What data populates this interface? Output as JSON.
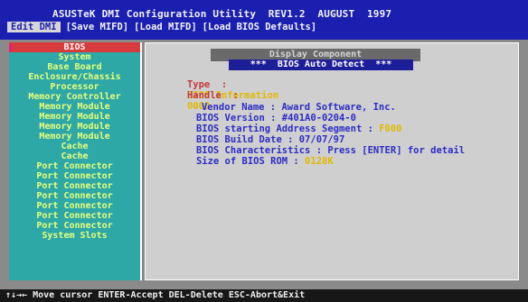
{
  "header": {
    "title": "ASUSTeK DMI Configuration Utility  REV1.2  AUGUST  1997",
    "menu": [
      {
        "label": "Edit DMI",
        "active": true
      },
      {
        "label": "[Save MIFD]",
        "active": false
      },
      {
        "label": "[Load MIFD]",
        "active": false
      },
      {
        "label": "[Load BIOS Defaults]",
        "active": false
      }
    ]
  },
  "sidebar": {
    "items": [
      {
        "label": "BIOS",
        "active": true
      },
      {
        "label": "System",
        "active": false
      },
      {
        "label": "Base Board",
        "active": false
      },
      {
        "label": "Enclosure/Chassis",
        "active": false
      },
      {
        "label": "Processor",
        "active": false
      },
      {
        "label": "Memory Controller",
        "active": false
      },
      {
        "label": "Memory Module",
        "active": false
      },
      {
        "label": "Memory Module",
        "active": false
      },
      {
        "label": "Memory Module",
        "active": false
      },
      {
        "label": "Memory Module",
        "active": false
      },
      {
        "label": "Cache",
        "active": false
      },
      {
        "label": "Cache",
        "active": false
      },
      {
        "label": "Port Connector",
        "active": false
      },
      {
        "label": "Port Connector",
        "active": false
      },
      {
        "label": "Port Connector",
        "active": false
      },
      {
        "label": "Port Connector",
        "active": false
      },
      {
        "label": "Port Connector",
        "active": false
      },
      {
        "label": "Port Connector",
        "active": false
      },
      {
        "label": "Port Connector",
        "active": false
      },
      {
        "label": "System Slots",
        "active": false
      }
    ]
  },
  "main": {
    "dialog_title": "Display Component",
    "section_header": "***  BIOS Auto Detect  ***",
    "type_label": "Type  :",
    "type_value": "BIOS Information",
    "handle_label": "Handle  :",
    "handle_value": "0000",
    "vendor_label": "Vendor Name : ",
    "vendor_value": "Award Software, Inc.",
    "version_label": "BIOS Version : ",
    "version_value": "#401A0-0204-0",
    "start_label": "BIOS starting Address Segment : ",
    "start_value": "F000",
    "date_label": "BIOS Build Date : ",
    "date_value": "07/07/97",
    "char_label": "BIOS Characteristics : ",
    "char_value": "Press [ENTER] for detail",
    "size_label": "Size of BIOS ROM : ",
    "size_value": "0128K"
  },
  "footer": {
    "help": "↑↓→← Move cursor ENTER-Accept DEL-Delete ESC-Abort&Exit"
  },
  "colors": {
    "header_bg": "#1a1fb0",
    "sidebar_bg": "#2ea8a6",
    "sidebar_text": "#e8ff7a",
    "sidebar_active": "#d83b3b",
    "main_bg": "#cfcfcf",
    "info_text": "#2c2cc7",
    "label_text": "#c33a3a"
  }
}
